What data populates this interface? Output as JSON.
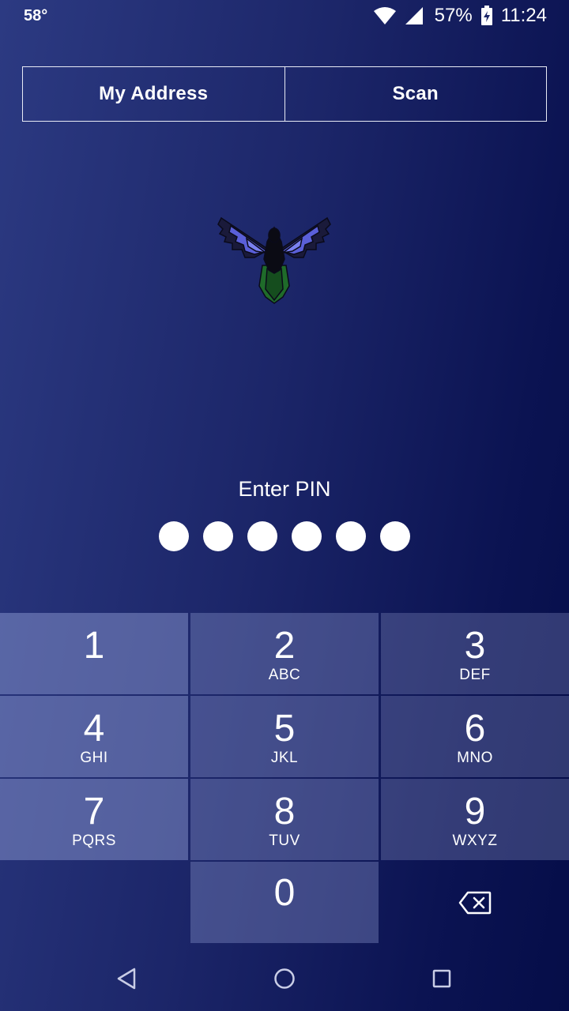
{
  "status_bar": {
    "temperature": "58°",
    "battery": "57%",
    "time": "11:24"
  },
  "top_buttons": {
    "my_address": "My Address",
    "scan": "Scan"
  },
  "pin": {
    "label": "Enter PIN",
    "length": 6
  },
  "keypad": {
    "keys": [
      {
        "num": "1",
        "letters": ""
      },
      {
        "num": "2",
        "letters": "ABC"
      },
      {
        "num": "3",
        "letters": "DEF"
      },
      {
        "num": "4",
        "letters": "GHI"
      },
      {
        "num": "5",
        "letters": "JKL"
      },
      {
        "num": "6",
        "letters": "MNO"
      },
      {
        "num": "7",
        "letters": "PQRS"
      },
      {
        "num": "8",
        "letters": "TUV"
      },
      {
        "num": "9",
        "letters": "WXYZ"
      },
      {
        "num": "0",
        "letters": ""
      }
    ]
  },
  "icons": {
    "backspace": "backspace-icon",
    "back": "back-triangle-icon",
    "home": "home-circle-icon",
    "recents": "recents-square-icon",
    "wifi": "wifi-icon",
    "signal": "signal-icon",
    "battery": "battery-charging-icon",
    "logo": "bird-logo-icon"
  },
  "colors": {
    "background_start": "#2c3a82",
    "background_end": "#050d48",
    "logo_wing": "#5a5fd8",
    "logo_tail": "#1f6b2a"
  }
}
